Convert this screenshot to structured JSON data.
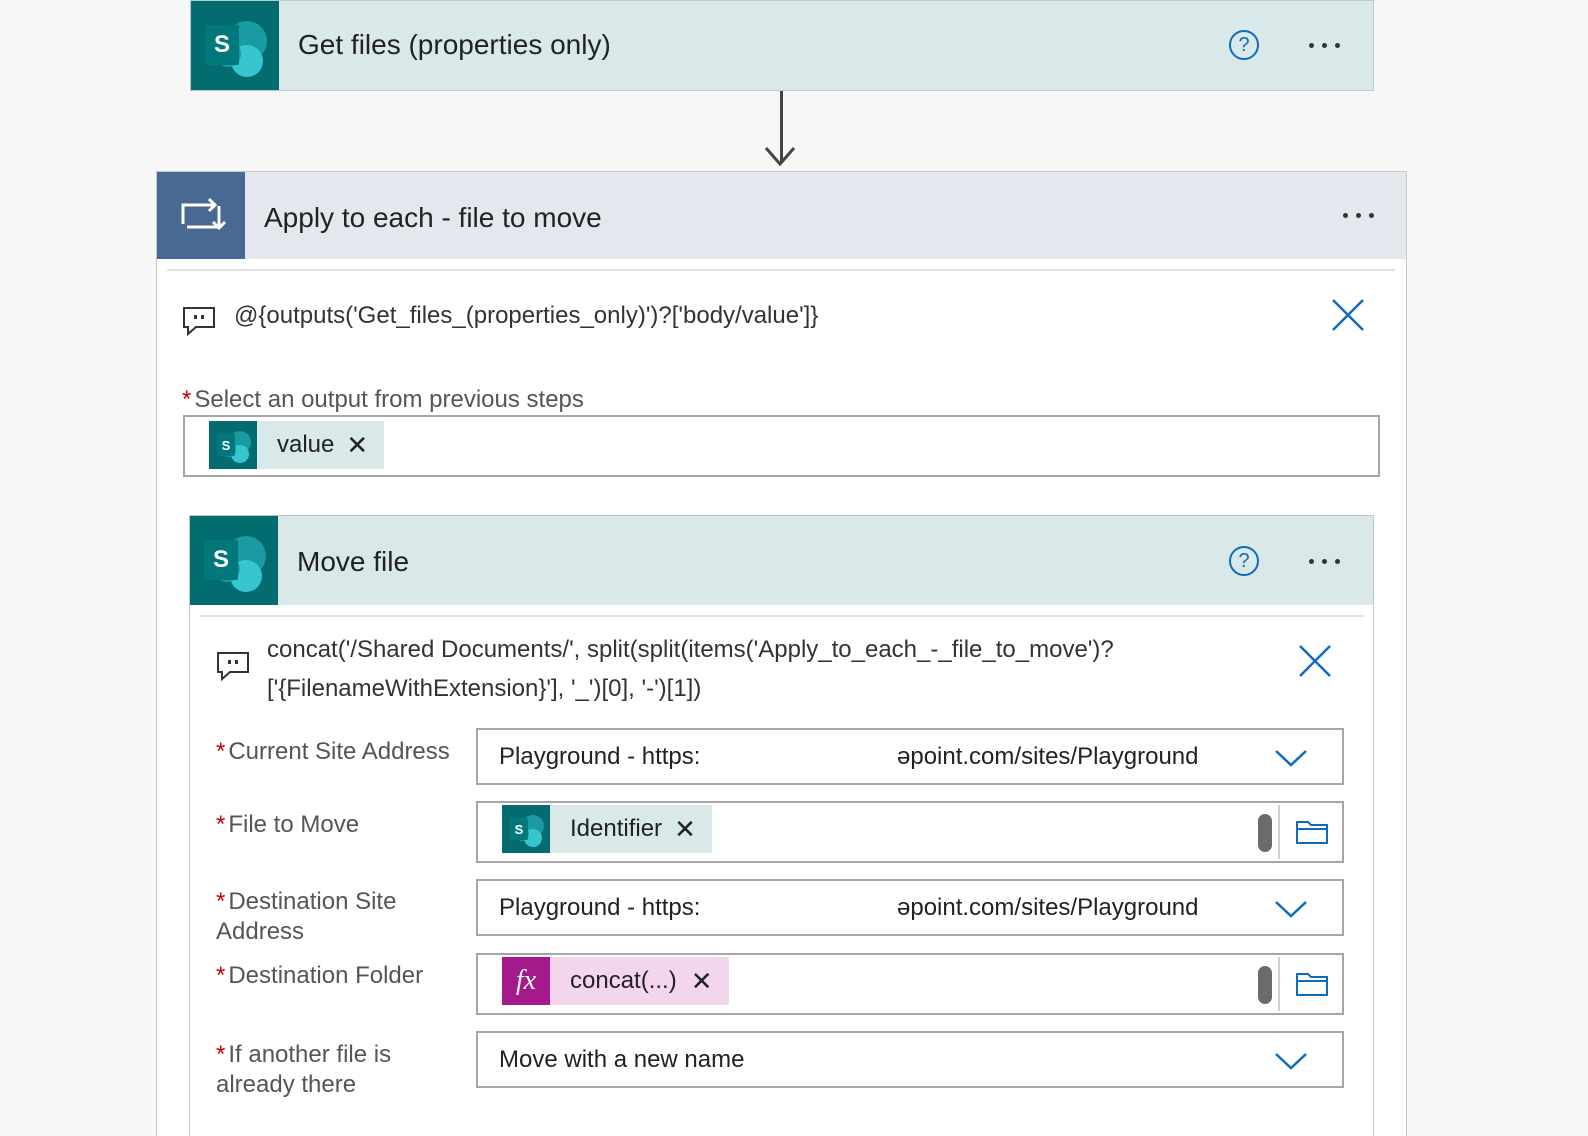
{
  "get_files": {
    "title": "Get files (properties only)",
    "help_icon": "?",
    "icon": "sharepoint-icon"
  },
  "apply_to_each": {
    "title": "Apply to each - file to move",
    "icon": "loop-icon",
    "expression": "@{outputs('Get_files_(properties_only)')?['body/value']}",
    "select_label": "Select an output from previous steps",
    "token_label": "value"
  },
  "move_file": {
    "title": "Move file",
    "help_icon": "?",
    "expression_line1": "concat('/Shared Documents/', split(split(items('Apply_to_each_-_file_to_move')?",
    "expression_line2": "['{FilenameWithExtension}'], '_')[0], '-')[1])",
    "fields": {
      "current_site": {
        "label": "Current Site Address",
        "value_left": "Playground - https:",
        "value_right": "əpoint.com/sites/Playground"
      },
      "file_to_move": {
        "label": "File to Move",
        "token": "Identifier"
      },
      "dest_site": {
        "label_line1": "Destination Site",
        "label_line2": "Address",
        "value_left": "Playground - https:",
        "value_right": "əpoint.com/sites/Playground"
      },
      "dest_folder": {
        "label": "Destination Folder",
        "token": "concat(...)",
        "fx": "fx"
      },
      "conflict": {
        "label_line1": "If another file is",
        "label_line2": "already there",
        "value": "Move with a new name"
      }
    }
  },
  "required_marker": "*",
  "colors": {
    "sharepoint": "#036c70",
    "loop_header": "#486991",
    "expression_purple": "#a4198b",
    "link_blue": "#0f6cbd"
  }
}
